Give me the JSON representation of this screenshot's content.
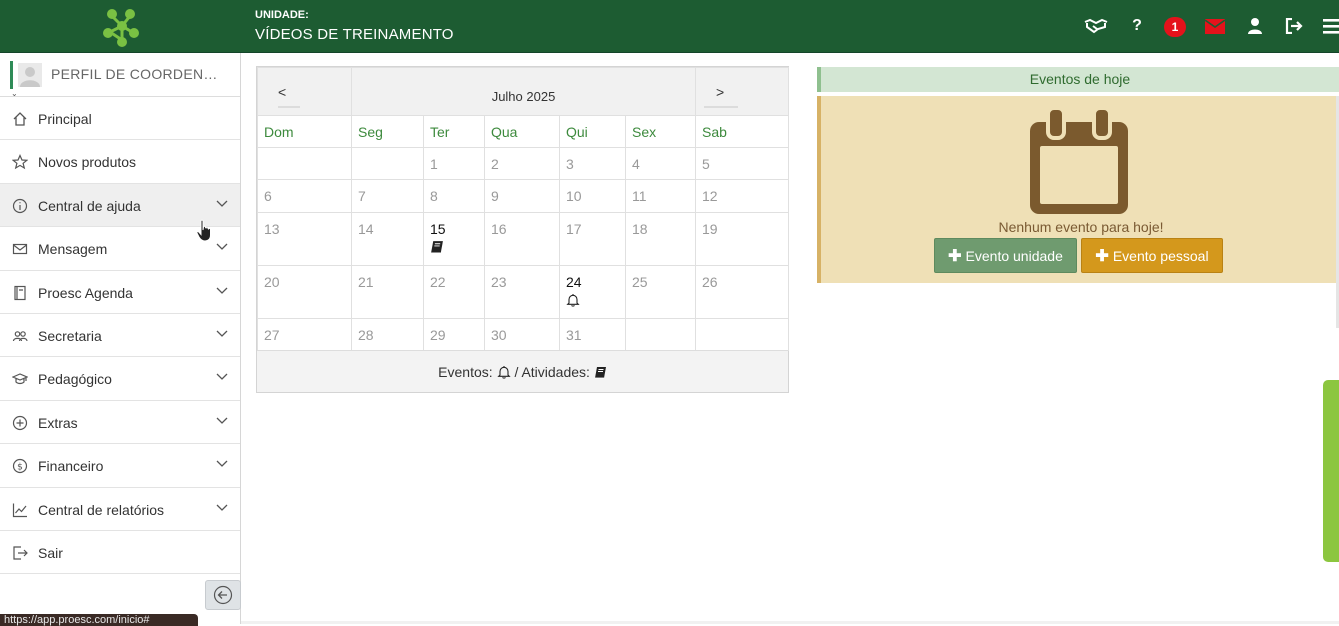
{
  "header": {
    "unit_label": "UNIDADE:",
    "unit_name": "VÍDEOS DE TREINAMENTO",
    "notification_count": "1",
    "help_label": "?",
    "icons": [
      "handshake-icon",
      "help-icon",
      "notification-badge",
      "mail-icon",
      "user-icon",
      "logout-icon",
      "hamburger-menu-icon"
    ],
    "colors": {
      "bar": "#1d5c32",
      "mail": "#e4121b",
      "logo": "#7ac143"
    }
  },
  "sidebar": {
    "profile_text": "PERFIL DE COORDENAÇÃO",
    "items": [
      {
        "label": "Principal",
        "icon": "home-icon",
        "expandable": false
      },
      {
        "label": "Novos produtos",
        "icon": "star-icon",
        "expandable": false
      },
      {
        "label": "Central de ajuda",
        "icon": "info-icon",
        "expandable": true
      },
      {
        "label": "Mensagem",
        "icon": "envelope-icon",
        "expandable": true
      },
      {
        "label": "Proesc Agenda",
        "icon": "agenda-book-icon",
        "expandable": true
      },
      {
        "label": "Secretaria",
        "icon": "people-icon",
        "expandable": true
      },
      {
        "label": "Pedagógico",
        "icon": "graduation-cap-icon",
        "expandable": true
      },
      {
        "label": "Extras",
        "icon": "plus-circle-icon",
        "expandable": true
      },
      {
        "label": "Financeiro",
        "icon": "dollar-circle-icon",
        "expandable": true
      },
      {
        "label": "Central de relatórios",
        "icon": "line-chart-icon",
        "expandable": true
      },
      {
        "label": "Sair",
        "icon": "exit-icon",
        "expandable": false
      }
    ],
    "status_url": "https://app.proesc.com/inicio#"
  },
  "calendar": {
    "prev_label": "<",
    "next_label": ">",
    "month_title": "Julho 2025",
    "weekdays": [
      "Dom",
      "Seg",
      "Ter",
      "Qua",
      "Qui",
      "Sex",
      "Sab"
    ],
    "weeks": [
      [
        "",
        "",
        "1",
        "2",
        "3",
        "4",
        "5"
      ],
      [
        "6",
        "7",
        "8",
        "9",
        "10",
        "11",
        "12"
      ],
      [
        "13",
        "14",
        "15",
        "16",
        "17",
        "18",
        "19"
      ],
      [
        "20",
        "21",
        "22",
        "23",
        "24",
        "25",
        "26"
      ],
      [
        "27",
        "28",
        "29",
        "30",
        "31",
        "",
        ""
      ]
    ],
    "marked_days": {
      "15": "activity-book-icon",
      "24": "event-bell-icon"
    },
    "legend_events": "Eventos:",
    "legend_sep": "/ Atividades:"
  },
  "today_events": {
    "title": "Eventos de hoje",
    "empty_text": "Nenhum evento para hoje!",
    "btn_unit": "Evento unidade",
    "btn_personal": "Evento pessoal",
    "colors": {
      "head_bg": "#d3e6d3",
      "box_bg": "#efe0b6",
      "btn_unit": "#6f9b6f",
      "btn_personal": "#d4981c"
    }
  }
}
